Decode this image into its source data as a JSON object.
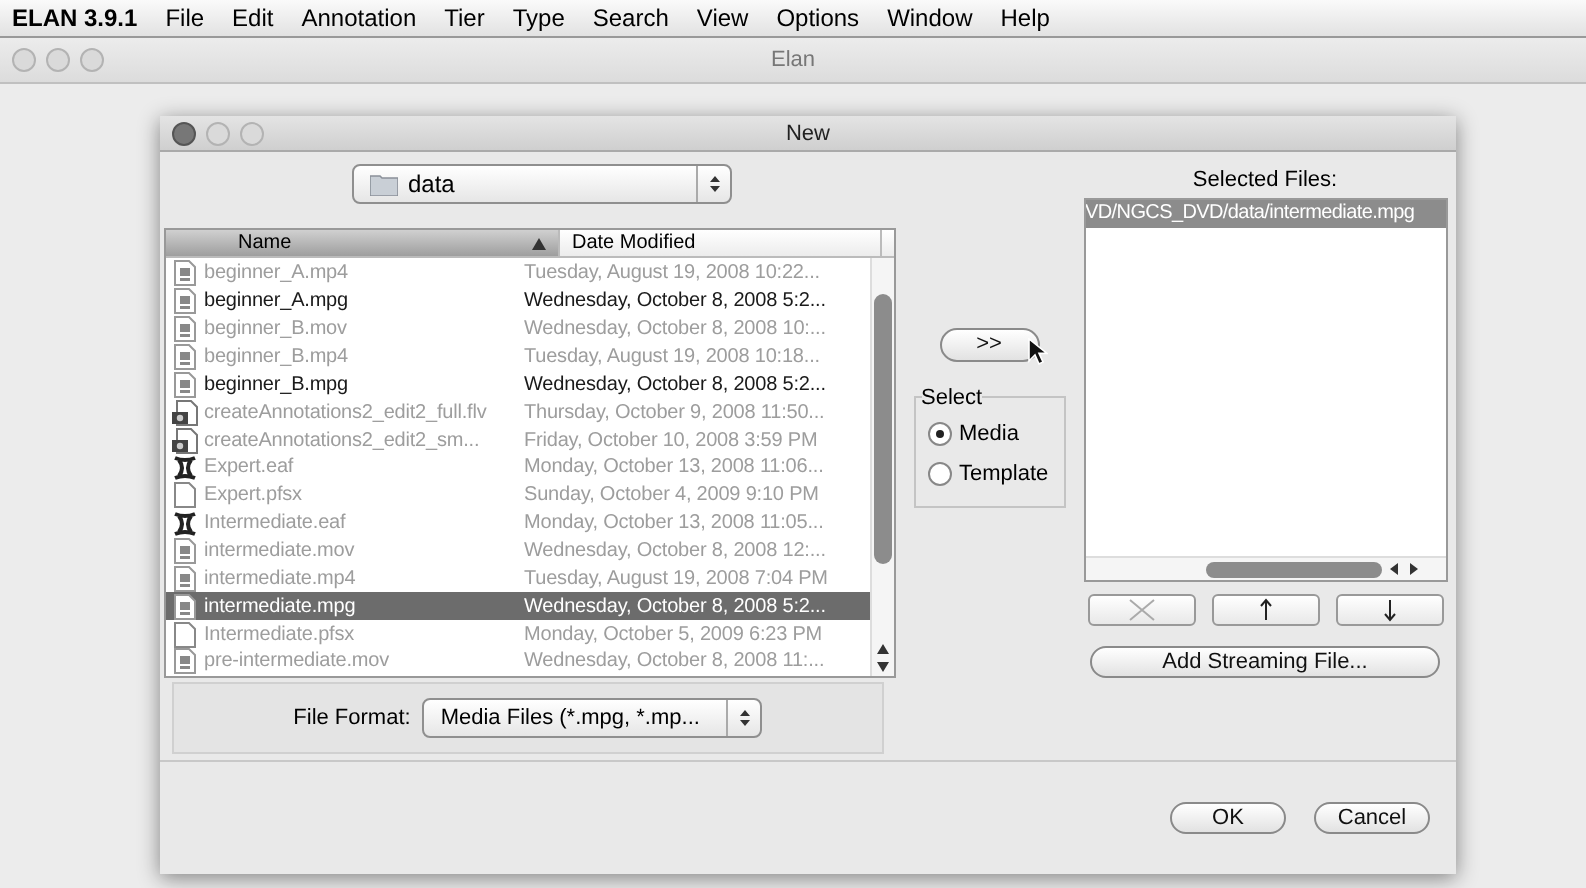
{
  "menu_bar": {
    "app": "ELAN 3.9.1",
    "items": [
      "File",
      "Edit",
      "Annotation",
      "Tier",
      "Type",
      "Search",
      "View",
      "Options",
      "Window",
      "Help"
    ]
  },
  "window": {
    "title": "Elan"
  },
  "dialog": {
    "title": "New",
    "folder_popup": {
      "value": "data"
    },
    "file_list": {
      "columns": [
        {
          "label": "Name",
          "sorted": true
        },
        {
          "label": "Date Modified",
          "sorted": false
        }
      ],
      "rows": [
        {
          "name": "beginner_A.mp4",
          "date": "Tuesday, August 19, 2008 10:22...",
          "kind": "media",
          "disabled": true,
          "selected": false
        },
        {
          "name": "beginner_A.mpg",
          "date": "Wednesday, October 8, 2008 5:2...",
          "kind": "media",
          "disabled": false,
          "selected": false
        },
        {
          "name": "beginner_B.mov",
          "date": "Wednesday, October 8, 2008 10:...",
          "kind": "media",
          "disabled": true,
          "selected": false
        },
        {
          "name": "beginner_B.mp4",
          "date": "Tuesday, August 19, 2008 10:18...",
          "kind": "media",
          "disabled": true,
          "selected": false
        },
        {
          "name": "beginner_B.mpg",
          "date": "Wednesday, October 8, 2008 5:2...",
          "kind": "media",
          "disabled": false,
          "selected": false
        },
        {
          "name": "createAnnotations2_edit2_full.flv",
          "date": "Thursday, October 9, 2008 11:50...",
          "kind": "flash",
          "disabled": true,
          "selected": false
        },
        {
          "name": "createAnnotations2_edit2_sm...",
          "date": "Friday, October 10, 2008 3:59 PM",
          "kind": "flash",
          "disabled": true,
          "selected": false
        },
        {
          "name": "Expert.eaf",
          "date": "Monday, October 13, 2008 11:06...",
          "kind": "eaf",
          "disabled": true,
          "selected": false
        },
        {
          "name": "Expert.pfsx",
          "date": "Sunday, October 4, 2009 9:10 PM",
          "kind": "blank",
          "disabled": true,
          "selected": false
        },
        {
          "name": "Intermediate.eaf",
          "date": "Monday, October 13, 2008 11:05...",
          "kind": "eaf",
          "disabled": true,
          "selected": false
        },
        {
          "name": "intermediate.mov",
          "date": "Wednesday, October 8, 2008 12:...",
          "kind": "media",
          "disabled": true,
          "selected": false
        },
        {
          "name": "intermediate.mp4",
          "date": "Tuesday, August 19, 2008 7:04 PM",
          "kind": "media",
          "disabled": true,
          "selected": false
        },
        {
          "name": "intermediate.mpg",
          "date": "Wednesday, October 8, 2008 5:2...",
          "kind": "media",
          "disabled": false,
          "selected": true
        },
        {
          "name": "Intermediate.pfsx",
          "date": "Monday, October 5, 2009 6:23 PM",
          "kind": "blank",
          "disabled": true,
          "selected": false
        },
        {
          "name": "pre-intermediate.mov",
          "date": "Wednesday, October 8, 2008 11:...",
          "kind": "media",
          "disabled": true,
          "selected": false
        }
      ]
    },
    "add_button": {
      "label": ">>"
    },
    "select_group": {
      "title": "Select",
      "options": [
        {
          "label": "Media",
          "selected": true
        },
        {
          "label": "Template",
          "selected": false
        }
      ]
    },
    "selected_files": {
      "title": "Selected Files:",
      "items": [
        {
          "path": "VD/NGCS_DVD/data/intermediate.mpg",
          "selected": true
        }
      ]
    },
    "list_buttons": [
      {
        "kind": "remove",
        "disabled": true
      },
      {
        "kind": "up",
        "disabled": false
      },
      {
        "kind": "down",
        "disabled": false
      }
    ],
    "add_streaming_button": "Add Streaming File...",
    "file_format": {
      "label": "File Format:",
      "value": "Media Files (*.mpg, *.mp..."
    },
    "buttons": [
      "OK",
      "Cancel"
    ]
  }
}
